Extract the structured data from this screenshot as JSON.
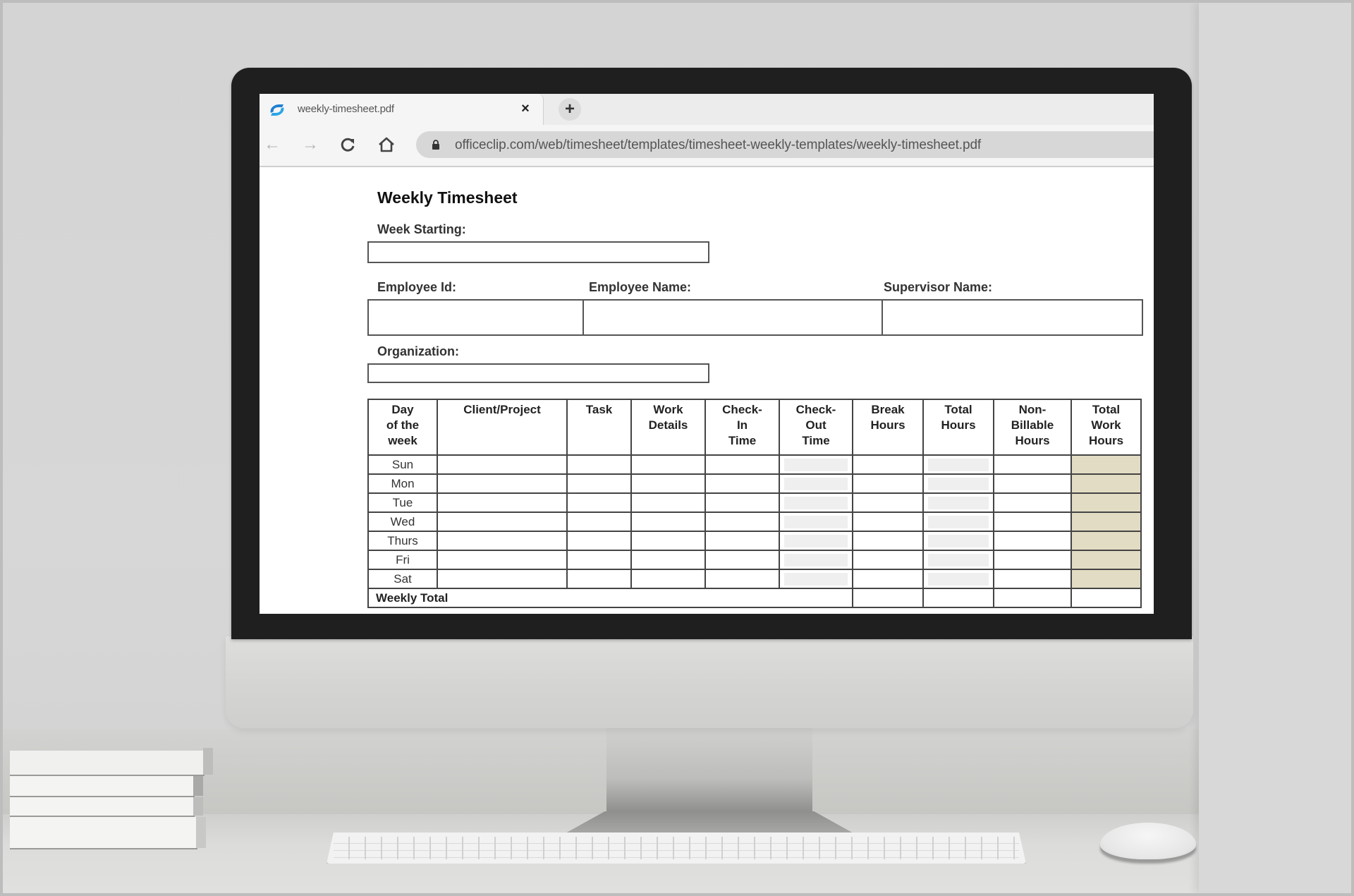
{
  "browser": {
    "tab": {
      "title": "weekly-timesheet.pdf",
      "close_label": "×",
      "favicon": "officeclip-icon"
    },
    "new_tab_label": "+",
    "nav": {
      "back": "←",
      "forward": "→",
      "reload": "C",
      "home": "⌂"
    },
    "address": {
      "url": "officeclip.com/web/timesheet/templates/timesheet-weekly-templates/weekly-timesheet.pdf",
      "secure_icon": "lock-icon"
    }
  },
  "document": {
    "title": "Weekly Timesheet",
    "fields": {
      "week_starting": {
        "label": "Week Starting:",
        "value": ""
      },
      "employee_id": {
        "label": "Employee Id:",
        "value": ""
      },
      "employee_name": {
        "label": "Employee Name:",
        "value": ""
      },
      "supervisor_name": {
        "label": "Supervisor Name:",
        "value": ""
      },
      "organization": {
        "label": "Organization:",
        "value": ""
      }
    },
    "table": {
      "headers": [
        "Day of the week",
        "Client/Project",
        "Task",
        "Work Details",
        "Check-In Time",
        "Check-Out Time",
        "Break Hours",
        "Total Hours",
        "Non-Billable Hours",
        "Total Work Hours"
      ],
      "header_lines": [
        [
          "Day",
          "of the",
          "week"
        ],
        [
          "Client/Project"
        ],
        [
          "Task"
        ],
        [
          "Work",
          "Details"
        ],
        [
          "Check-",
          "In",
          "Time"
        ],
        [
          "Check-",
          "Out",
          "Time"
        ],
        [
          "Break",
          "Hours"
        ],
        [
          "Total",
          "Hours"
        ],
        [
          "Non-",
          "Billable",
          "Hours"
        ],
        [
          "Total",
          "Work",
          "Hours"
        ]
      ],
      "days": [
        "Sun",
        "Mon",
        "Tue",
        "Wed",
        "Thurs",
        "Fri",
        "Sat"
      ],
      "weekly_total_label": "Weekly Total"
    },
    "colors": {
      "total_work_hours_fill": "#e2dcc4",
      "computed_cell_fill": "#efefef",
      "grid_line": "#444444"
    }
  }
}
